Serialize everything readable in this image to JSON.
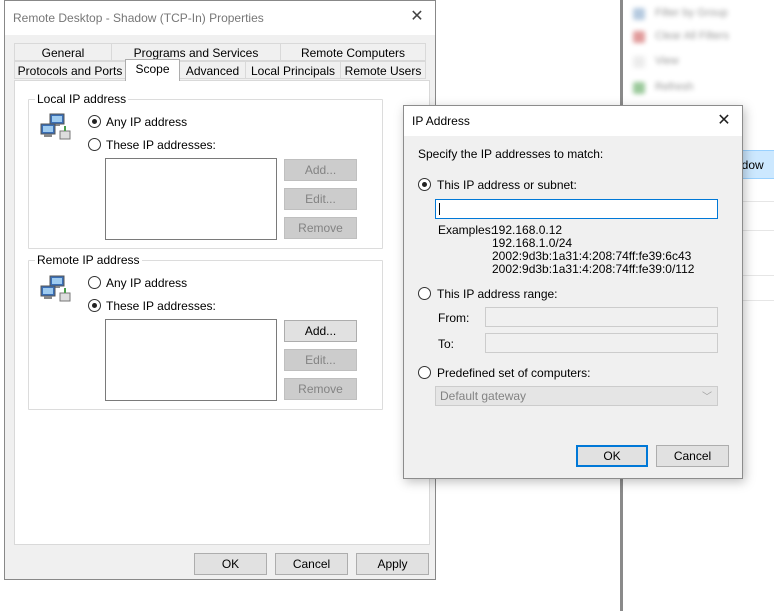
{
  "background": {
    "selected_row_text": "adow",
    "rows": [
      {
        "label": "Filter by Group",
        "color": "#7a9fc7"
      },
      {
        "label": "Clear All Filters",
        "color": "#c94b4b"
      },
      {
        "label": "View",
        "color": "#bbbbbb"
      },
      {
        "label": "Refresh",
        "color": "#4a9e4a"
      }
    ]
  },
  "main_window": {
    "title": "Remote Desktop - Shadow (TCP-In) Properties",
    "tabs_row1": [
      "General",
      "Programs and Services",
      "Remote Computers"
    ],
    "tabs_row2": [
      "Protocols and Ports",
      "Scope",
      "Advanced",
      "Local Principals",
      "Remote Users"
    ],
    "local": {
      "legend": "Local IP address",
      "any_label": "Any IP address",
      "these_label": "These IP addresses:",
      "add": "Add...",
      "edit": "Edit...",
      "remove": "Remove"
    },
    "remote": {
      "legend": "Remote IP address",
      "any_label": "Any IP address",
      "these_label": "These IP addresses:",
      "add": "Add...",
      "edit": "Edit...",
      "remove": "Remove"
    },
    "footer": {
      "ok": "OK",
      "cancel": "Cancel",
      "apply": "Apply"
    }
  },
  "ip_dialog": {
    "title": "IP Address",
    "instruction": "Specify the IP addresses to match:",
    "subnet_label": "This IP address or subnet:",
    "subnet_value": "",
    "examples_label": "Examples:",
    "examples": [
      "192.168.0.12",
      "192.168.1.0/24",
      "2002:9d3b:1a31:4:208:74ff:fe39:6c43",
      "2002:9d3b:1a31:4:208:74ff:fe39:0/112"
    ],
    "range_label": "This IP address range:",
    "from_label": "From:",
    "to_label": "To:",
    "predefined_label": "Predefined set of computers:",
    "predefined_value": "Default gateway",
    "ok": "OK",
    "cancel": "Cancel"
  },
  "colors": {
    "accent": "#0078d7",
    "selection": "#cce8ff"
  }
}
